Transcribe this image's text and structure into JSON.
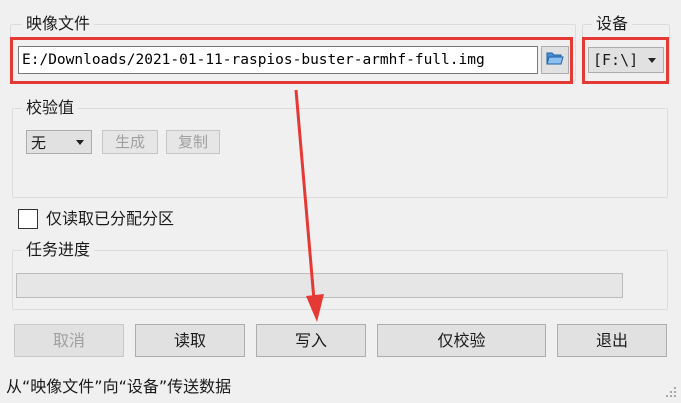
{
  "image_file": {
    "label": "映像文件",
    "path": "E:/Downloads/2021-01-11-raspios-buster-armhf-full.img",
    "browse_icon": "folder-open-icon"
  },
  "device": {
    "label": "设备",
    "selected": "[F:\\]"
  },
  "hash": {
    "label": "校验值",
    "selected": "无",
    "generate_label": "生成",
    "copy_label": "复制"
  },
  "read_only_option": {
    "label": "仅读取已分配分区",
    "checked": false
  },
  "progress": {
    "label": "任务进度",
    "value": 0
  },
  "buttons": {
    "cancel": "取消",
    "read": "读取",
    "write": "写入",
    "verify_only": "仅校验",
    "exit": "退出"
  },
  "status": {
    "text": "从“映像文件”向“设备”传送数据"
  },
  "annotation_color": "#e53935"
}
